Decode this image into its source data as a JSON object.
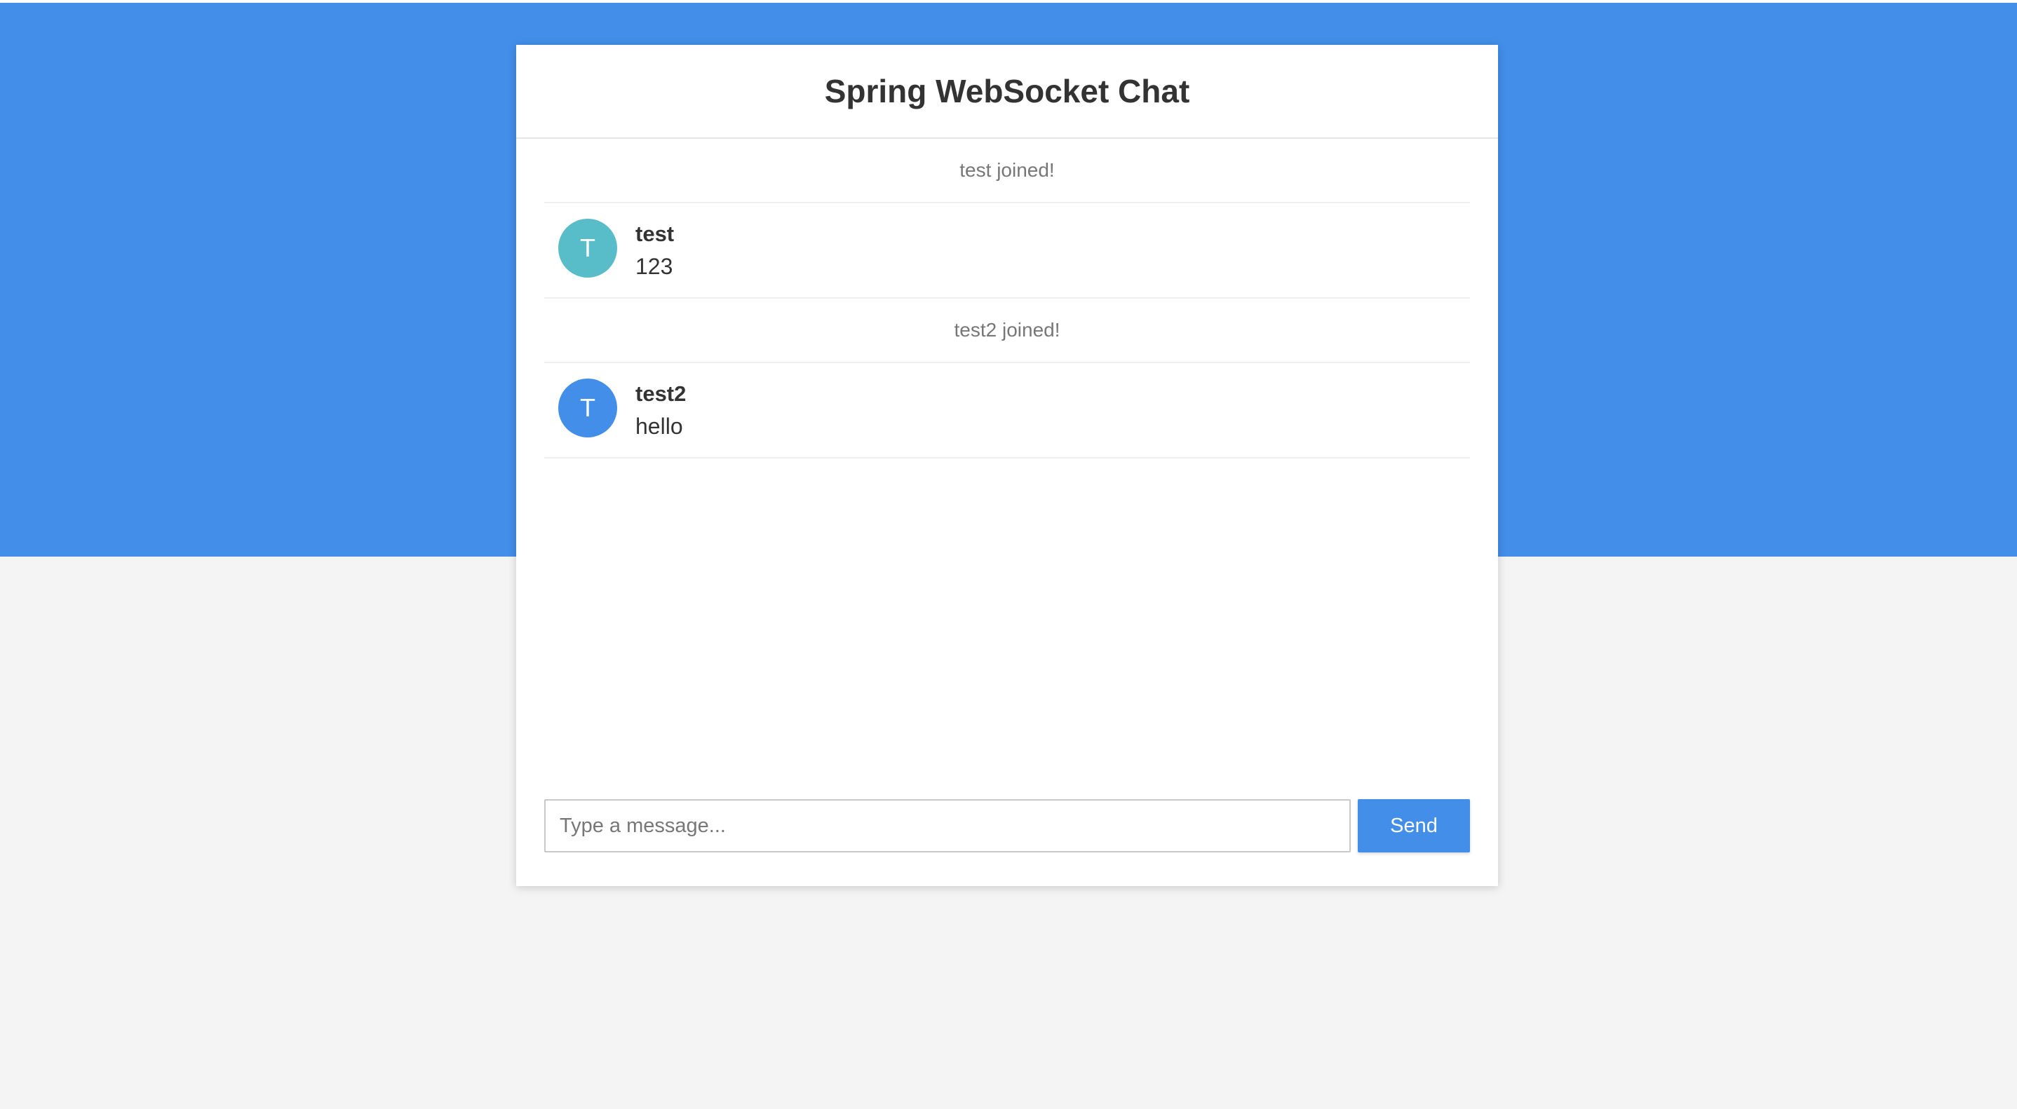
{
  "header": {
    "title": "Spring WebSocket Chat"
  },
  "messages": [
    {
      "type": "event",
      "text": "test joined!"
    },
    {
      "type": "chat",
      "avatar_letter": "T",
      "avatar_color": "#59bcc9",
      "sender": "test",
      "content": "123"
    },
    {
      "type": "event",
      "text": "test2 joined!"
    },
    {
      "type": "chat",
      "avatar_letter": "T",
      "avatar_color": "#428ee9",
      "sender": "test2",
      "content": "hello"
    }
  ],
  "composer": {
    "placeholder": "Type a message...",
    "value": "",
    "send_label": "Send"
  },
  "colors": {
    "accent": "#428ee9",
    "background": "#f4f4f4"
  }
}
